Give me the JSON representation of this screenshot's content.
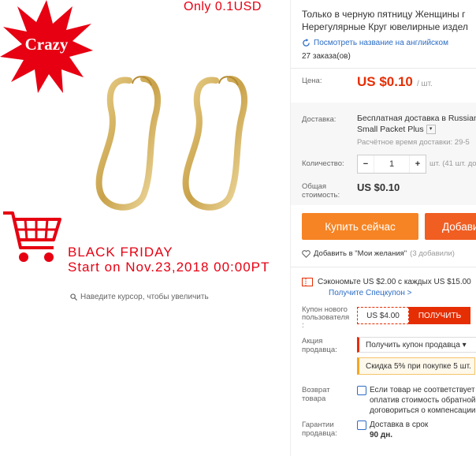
{
  "promo": {
    "badge": "Crazy",
    "price_note": "Only 0.1USD",
    "bf_line1": "BLACK FRIDAY",
    "bf_line2": "Start on Nov.23,2018 00:00PT",
    "zoom_hint": "Наведите курсор, чтобы увеличить"
  },
  "product": {
    "title_line1": "Только в черную пятницу Женщины г",
    "title_line2": "Нерегулярные Круг ювелирные издел",
    "translate_link": "Посмотреть название на английском",
    "orders": "27 заказа(ов)"
  },
  "price": {
    "label": "Цена:",
    "value": "US $0.10",
    "unit": "/ шт."
  },
  "shipping": {
    "label": "Доставка:",
    "value": "Бесплатная доставка в Russian",
    "method": "Small Packet Plus",
    "time": "Расчётное время доставки: 29-5"
  },
  "quantity": {
    "label": "Количество:",
    "minus": "−",
    "value": "1",
    "plus": "+",
    "unit": "шт. (41 шт. до"
  },
  "total": {
    "label_line1": "Общая",
    "label_line2": "стоимость:",
    "value": "US $0.10"
  },
  "buttons": {
    "buy_now": "Купить сейчас",
    "add_cart": "Добави"
  },
  "wishlist": {
    "label": "Добавить в \"Мои желания\"",
    "count": "(3 добавили)"
  },
  "savings": {
    "text": "Сэкономьте US $2.00 с каждых US $15.00",
    "link": "Получите Спецкупон >"
  },
  "coupon": {
    "label_line1": "Купон нового",
    "label_line2": "пользователя",
    "label_line3": ":",
    "value": "US $4.00",
    "button": "ПОЛУЧИТЬ"
  },
  "seller_promo": {
    "label_line1": "Акция",
    "label_line2": "продавца:",
    "select": "Получить купон продавца ▾",
    "discount": "Скидка 5% при покупке 5 шт."
  },
  "returns": {
    "label_line1": "Возврат",
    "label_line2": "товара",
    "line1": "Если товар не соответствует",
    "line2": "оплатив стоимость обратной",
    "line3": "договориться о компенсации"
  },
  "guarantee": {
    "label_line1": "Гарантии",
    "label_line2": "продавца:",
    "line1": "Доставка в срок",
    "line2": "90 дн."
  },
  "colors": {
    "accent_red": "#e62e04",
    "buy_orange": "#f68424",
    "cart_orange": "#f05e22",
    "link_blue": "#2b6cc4",
    "promo_red": "#e60012"
  }
}
